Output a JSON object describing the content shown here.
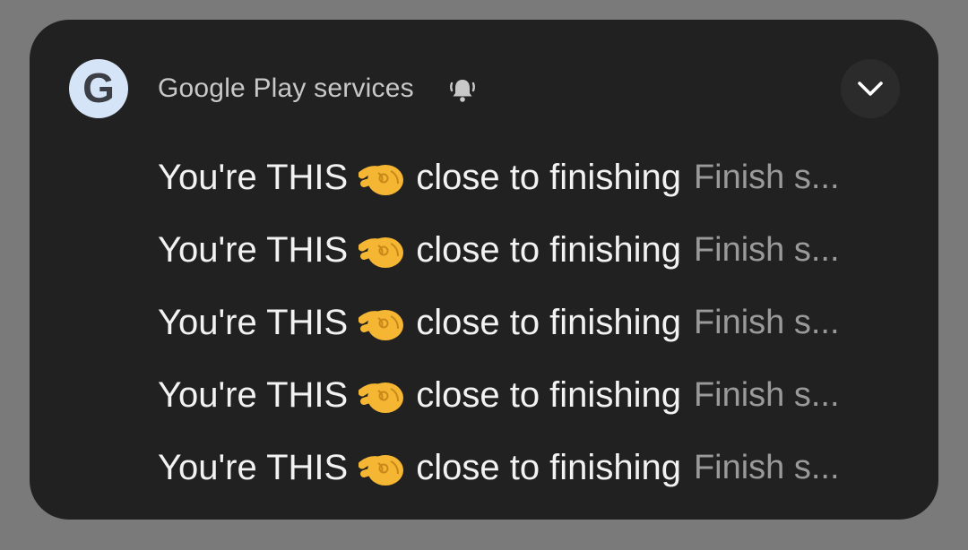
{
  "notification": {
    "app_name": "Google Play services",
    "app_icon_letter": "G",
    "icons": {
      "app": "google-g-icon",
      "alert": "bell-ringing-icon",
      "expand": "chevron-down-icon",
      "emoji": "pinching-hand-emoji"
    },
    "colors": {
      "card_background": "#212121",
      "backdrop": "#7a7a7a",
      "title_text": "#f2f2f2",
      "secondary_text": "#9a9a9a",
      "app_icon_bg": "#d6e4f7"
    },
    "messages": [
      {
        "title_before": "You're THIS",
        "title_after": "close to finishing",
        "body": "Finish s..."
      },
      {
        "title_before": "You're THIS",
        "title_after": "close to finishing",
        "body": "Finish s..."
      },
      {
        "title_before": "You're THIS",
        "title_after": "close to finishing",
        "body": "Finish s..."
      },
      {
        "title_before": "You're THIS",
        "title_after": "close to finishing",
        "body": "Finish s..."
      },
      {
        "title_before": "You're THIS",
        "title_after": "close to finishing",
        "body": "Finish s..."
      }
    ]
  }
}
